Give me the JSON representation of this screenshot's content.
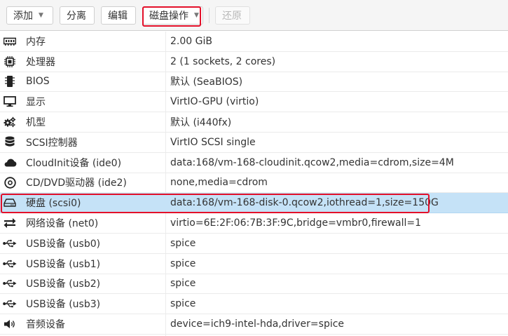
{
  "toolbar": {
    "add_label": "添加",
    "detach_label": "分离",
    "edit_label": "编辑",
    "disk_action_label": "磁盘操作",
    "revert_label": "还原"
  },
  "rows": [
    {
      "icon": "memory-icon",
      "key": "内存",
      "value": "2.00 GiB"
    },
    {
      "icon": "cpu-icon",
      "key": "处理器",
      "value": "2 (1 sockets, 2 cores)"
    },
    {
      "icon": "bios-chip-icon",
      "key": "BIOS",
      "value": "默认 (SeaBIOS)"
    },
    {
      "icon": "monitor-icon",
      "key": "显示",
      "value": "VirtIO-GPU (virtio)"
    },
    {
      "icon": "cogs-icon",
      "key": "机型",
      "value": "默认 (i440fx)"
    },
    {
      "icon": "database-icon",
      "key": "SCSI控制器",
      "value": "VirtIO SCSI single"
    },
    {
      "icon": "cloud-icon",
      "key": "CloudInit设备 (ide0)",
      "value": "data:168/vm-168-cloudinit.qcow2,media=cdrom,size=4M"
    },
    {
      "icon": "cdrom-icon",
      "key": "CD/DVD驱动器 (ide2)",
      "value": "none,media=cdrom"
    },
    {
      "icon": "hdd-icon",
      "key": "硬盘 (scsi0)",
      "value": "data:168/vm-168-disk-0.qcow2,iothread=1,size=150G"
    },
    {
      "icon": "exchange-icon",
      "key": "网络设备 (net0)",
      "value": "virtio=6E:2F:06:7B:3F:9C,bridge=vmbr0,firewall=1"
    },
    {
      "icon": "usb-icon",
      "key": "USB设备 (usb0)",
      "value": "spice"
    },
    {
      "icon": "usb-icon",
      "key": "USB设备 (usb1)",
      "value": "spice"
    },
    {
      "icon": "usb-icon",
      "key": "USB设备 (usb2)",
      "value": "spice"
    },
    {
      "icon": "usb-icon",
      "key": "USB设备 (usb3)",
      "value": "spice"
    },
    {
      "icon": "volume-icon",
      "key": "音频设备",
      "value": "device=ich9-intel-hda,driver=spice"
    }
  ],
  "selected_row": "硬盘 (scsi0)",
  "colors": {
    "selection": "#c5e2f7",
    "highlight_box": "#e3102a"
  }
}
